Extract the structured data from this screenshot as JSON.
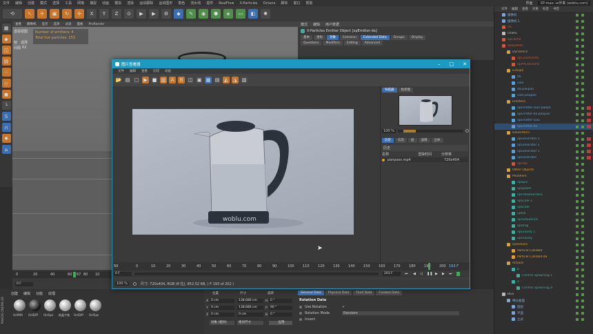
{
  "menubar": {
    "items": [
      "文件",
      "编辑",
      "创建",
      "模式",
      "选择",
      "工具",
      "网格",
      "捕捉",
      "动画",
      "模拟",
      "渲染",
      "运动跟踪",
      "运动图形",
      "角色",
      "流水线",
      "插件",
      "RealFlow",
      "X-Particles",
      "Octane",
      "脚本",
      "窗口",
      "帮助"
    ],
    "right_label": "界面",
    "right_value": "XP-mao--w伴奏 (woblu.com)"
  },
  "viewport": {
    "menu": [
      "查看",
      "摄像机",
      "显示",
      "选项",
      "过滤",
      "面板",
      "ProRender"
    ],
    "hud": {
      "line1_label": "Number of emitters:",
      "line1_value": "4",
      "line2_label": "Total live particles:",
      "line2_value": "153"
    },
    "left_labels": [
      "透视视图",
      "帧",
      "选择",
      "间隔",
      "62"
    ]
  },
  "timeline": {
    "ticks": [
      "0",
      "20",
      "40",
      "60",
      "67",
      "80",
      "10"
    ],
    "frame_value": "0 F"
  },
  "attributes": {
    "title": "X-Particles Emitter Object [xpEmitter-da]",
    "header_tabs": [
      "模式",
      "编辑",
      "用户数据"
    ],
    "tabs_row1": [
      "基本",
      "坐标",
      "对象",
      "Emission",
      "Extended Data",
      "Groups",
      "Display"
    ],
    "tabs_row2": [
      "Questions",
      "Modifiers",
      "Editing",
      "Advanced"
    ],
    "active_tab": "对象",
    "side_label": "属性"
  },
  "picture_viewer": {
    "title": "图片查看器",
    "menu": [
      "文件",
      "编辑",
      "查看",
      "比较",
      "动画"
    ],
    "watermark": "woblu.com",
    "nav_tabs": [
      "导航器",
      "柱状图"
    ],
    "zoom": "100 %",
    "info_tabs": [
      "历史",
      "信息",
      "层",
      "滤镜",
      "立体"
    ],
    "history_label": "历史",
    "table_headers": [
      "名称",
      "渲染时间",
      "分辨率"
    ],
    "table_row": {
      "name": "panpass.mp4",
      "time": "",
      "res": "720x404"
    },
    "ruler_ticks": [
      "0",
      "10",
      "20",
      "30",
      "40",
      "50",
      "60",
      "70",
      "80",
      "90",
      "100",
      "110",
      "120",
      "130",
      "140",
      "150",
      "160",
      "170",
      "180",
      "190",
      "200"
    ],
    "ruler_left": "50",
    "ruler_right": "193 F",
    "play_left": "0 F",
    "play_frame": "203 F",
    "status_zoom": "100 %",
    "status_text": "尺寸: 720x404, RGB (8 位), 852.52 KB,  ( F 193 of 202 )"
  },
  "coords": {
    "headers": [
      "位置",
      "尺寸",
      "旋转"
    ],
    "rows": [
      {
        "axis": "X",
        "pos": "0 cm",
        "size": "138.686 cm",
        "rot_axis": "H",
        "rot": "0 °"
      },
      {
        "axis": "Y",
        "pos": "0 cm",
        "size": "138.686 cm",
        "rot_axis": "P",
        "rot": "90 °"
      },
      {
        "axis": "Z",
        "pos": "0 cm",
        "size": "0 cm",
        "rot_axis": "B",
        "rot": "0 °"
      }
    ],
    "mode1": "对象 (相对)",
    "mode2": "绝对尺寸",
    "apply": "应用"
  },
  "bottom_attr": {
    "tabs": [
      "General Data",
      "Physical Data",
      "Fluid Data",
      "Custom Data"
    ],
    "section": "Rotation Data",
    "rows": [
      {
        "label": "Use Rotation",
        "value": "✓"
      },
      {
        "label": "Rotation Mode",
        "value": "Random"
      },
      {
        "label": "Invert",
        "value": ""
      }
    ]
  },
  "materials": {
    "menu": [
      "创建",
      "编辑",
      "功能",
      "纹理"
    ],
    "labels": [
      "OrtMAt",
      "OctDiff",
      "OctSpe",
      "结晶宁锥",
      "OctDiff",
      "OctSpe"
    ],
    "brand": "MAXON CINEMA 4D"
  },
  "object_manager": {
    "menu": [
      "文件",
      "编辑",
      "查看",
      "对象",
      "标签",
      "书签"
    ],
    "items": [
      {
        "label": "摄像机",
        "indent": 1,
        "color": "#7aa7d6"
      },
      {
        "label": "摄像机.1",
        "indent": 1,
        "color": "#7aa7d6"
      },
      {
        "label": "OC",
        "indent": 1,
        "color": "#d25a3a"
      },
      {
        "label": "chahu",
        "indent": 1,
        "color": "#bbbbbb"
      },
      {
        "label": "xpCache",
        "indent": 1,
        "color": "#d25a3a"
      },
      {
        "label": "xpSystem",
        "indent": 1,
        "color": "#d25a3a"
      },
      {
        "label": "Dynamics",
        "indent": 2,
        "color": "#e0a030"
      },
      {
        "label": "xpConstraints",
        "indent": 3,
        "color": "#d25a3a"
      },
      {
        "label": "xpPPCollisions",
        "indent": 3,
        "color": "#d25a3a"
      },
      {
        "label": "Groups",
        "indent": 2,
        "color": "#e0a030"
      },
      {
        "label": "da",
        "indent": 3,
        "color": "#5aa0d0"
      },
      {
        "label": "xiao",
        "indent": 3,
        "color": "#5aa0d0"
      },
      {
        "label": "da-paopao",
        "indent": 3,
        "color": "#5aa0d0"
      },
      {
        "label": "xiao-paopao",
        "indent": 3,
        "color": "#5aa0d0"
      },
      {
        "label": "Emitters",
        "indent": 2,
        "color": "#e0a030"
      },
      {
        "label": "xpEmitter-xiao-paopa",
        "indent": 3,
        "color": "#5aa0d0"
      },
      {
        "label": "xpEmitter-da-paopao",
        "indent": 3,
        "color": "#5aa0d0"
      },
      {
        "label": "xpEmitter-xiao",
        "indent": 3,
        "color": "#5aa0d0"
      },
      {
        "label": "xpEmitter-da",
        "indent": 3,
        "color": "#5aa0d0"
      },
      {
        "label": "Generators",
        "indent": 2,
        "color": "#e0a030"
      },
      {
        "label": "xpGenerator 3",
        "indent": 3,
        "color": "#5aa0d0"
      },
      {
        "label": "xpGenerator 2",
        "indent": 3,
        "color": "#5aa0d0"
      },
      {
        "label": "xpGenerator 1",
        "indent": 3,
        "color": "#5aa0d0"
      },
      {
        "label": "xpGenerator",
        "indent": 3,
        "color": "#5aa0d0"
      },
      {
        "label": "xpTrail",
        "indent": 3,
        "color": "#d25a3a"
      },
      {
        "label": "Other Objects",
        "indent": 2,
        "color": "#e0a030"
      },
      {
        "label": "Modifiers",
        "indent": 2,
        "color": "#e0a030"
      },
      {
        "label": "xpSpin",
        "indent": 3,
        "color": "#3fb0a0"
      },
      {
        "label": "xpSpawn",
        "indent": 3,
        "color": "#3fb0a0"
      },
      {
        "label": "xpFollowSurface",
        "indent": 3,
        "color": "#3fb0a0"
      },
      {
        "label": "xpScale 1",
        "indent": 3,
        "color": "#3fb0a0"
      },
      {
        "label": "xpScale",
        "indent": 3,
        "color": "#3fb0a0"
      },
      {
        "label": "xpKill",
        "indent": 3,
        "color": "#3fb0a0"
      },
      {
        "label": "xpTurbulence",
        "indent": 3,
        "color": "#3fb0a0"
      },
      {
        "label": "xpDrag",
        "indent": 3,
        "color": "#3fb0a0"
      },
      {
        "label": "xpGravity 1",
        "indent": 3,
        "color": "#3fb0a0"
      },
      {
        "label": "xpGravity",
        "indent": 3,
        "color": "#3fb0a0"
      },
      {
        "label": "Questions",
        "indent": 2,
        "color": "#e0a030"
      },
      {
        "label": "Particle Collided",
        "indent": 3,
        "color": "#e0a030"
      },
      {
        "label": "Particle Collided-da",
        "indent": 3,
        "color": "#e0a030"
      },
      {
        "label": "Actions",
        "indent": 2,
        "color": "#e0a030"
      },
      {
        "label": "b",
        "indent": 3,
        "color": "#3fb0a0"
      },
      {
        "label": "Control Spawning.1",
        "indent": 4,
        "color": "#3fb0a0"
      },
      {
        "label": "a",
        "indent": 3,
        "color": "#3fb0a0"
      },
      {
        "label": "Control Spawning.4",
        "indent": 4,
        "color": "#3fb0a0"
      },
      {
        "label": "BGS",
        "indent": 1,
        "color": "#bbbbbb"
      },
      {
        "label": "细分曲面",
        "indent": 2,
        "color": "#7aa7d6"
      },
      {
        "label": "圆盘",
        "indent": 3,
        "color": "#7aa7d6"
      },
      {
        "label": "平面",
        "indent": 3,
        "color": "#7aa7d6"
      },
      {
        "label": "立式",
        "indent": 3,
        "color": "#7aa7d6"
      }
    ]
  },
  "colors": {
    "accent": "#1c9bc2",
    "selected": "#3a6fb3",
    "orange": "#e0a030",
    "red": "#c23b3b"
  }
}
